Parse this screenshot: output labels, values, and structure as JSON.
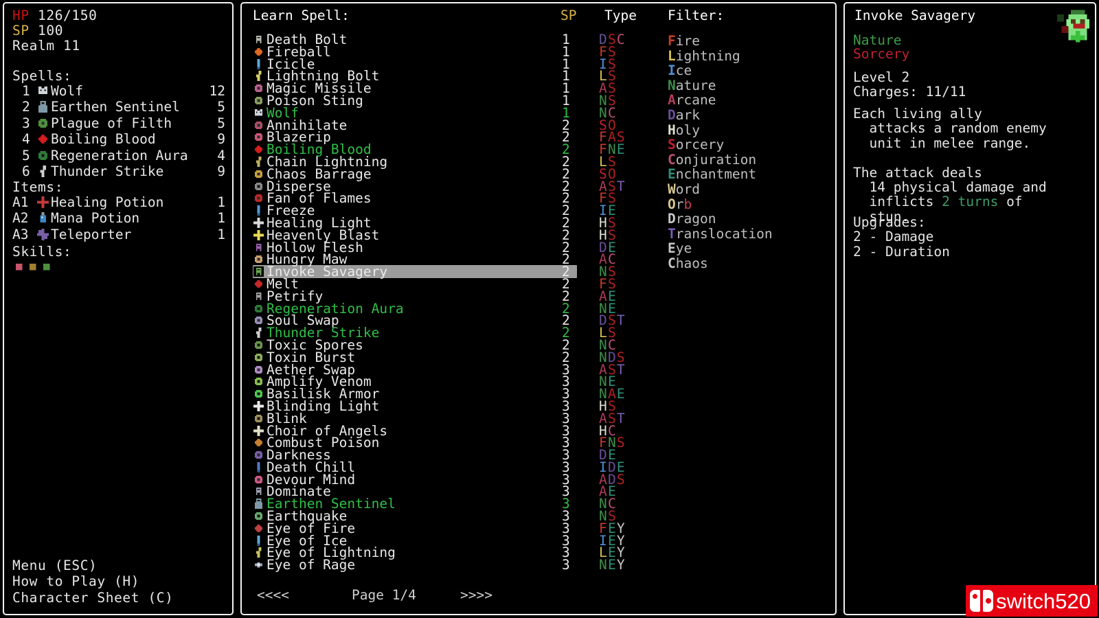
{
  "stats": {
    "hp_label": "HP",
    "hp_value": "126/150",
    "sp_label": "SP",
    "sp_value": "100",
    "realm": "Realm 11"
  },
  "spells_section": {
    "heading": "Spells:",
    "items": [
      {
        "num": "1",
        "name": "Wolf",
        "count": "12",
        "icon": "wolf-icon",
        "color": "#cfd4d8"
      },
      {
        "num": "2",
        "name": "Earthen Sentinel",
        "count": "5",
        "icon": "sentinel-icon",
        "color": "#7f9aa6"
      },
      {
        "num": "3",
        "name": "Plague of Filth",
        "count": "5",
        "icon": "plague-icon",
        "color": "#4f8f3f"
      },
      {
        "num": "4",
        "name": "Boiling Blood",
        "count": "9",
        "icon": "blood-icon",
        "color": "#d61c1c"
      },
      {
        "num": "5",
        "name": "Regeneration Aura",
        "count": "4",
        "icon": "regen-icon",
        "color": "#2f7a3a"
      },
      {
        "num": "6",
        "name": "Thunder Strike",
        "count": "9",
        "icon": "thunder-icon",
        "color": "#cfcfcf"
      }
    ]
  },
  "items_section": {
    "heading": "Items:",
    "items": [
      {
        "slot": "A1",
        "name": "Healing Potion",
        "count": "1",
        "icon": "healing-potion-icon",
        "color": "#c43a3a"
      },
      {
        "slot": "A2",
        "name": "Mana Potion",
        "count": "1",
        "icon": "mana-potion-icon",
        "color": "#3a86c4"
      },
      {
        "slot": "A3",
        "name": "Teleporter",
        "count": "1",
        "icon": "teleporter-icon",
        "color": "#7a5fa8"
      }
    ]
  },
  "skills_section": {
    "heading": "Skills:",
    "icons": [
      {
        "name": "skill-flesh-icon",
        "color": "#c8566b"
      },
      {
        "name": "skill-shield-icon",
        "color": "#a08030"
      },
      {
        "name": "skill-nature-icon",
        "color": "#4f8f3f"
      }
    ]
  },
  "footer": {
    "lines": [
      "Menu (ESC)",
      "How to Play (H)",
      "Character Sheet (C)"
    ]
  },
  "center": {
    "title": "Learn Spell:",
    "sp_header": "SP",
    "type_header": "Type",
    "filter_header": "Filter:",
    "pager": {
      "prev": "<<<<",
      "label": "Page 1/4",
      "next": ">>>>"
    }
  },
  "spell_list": [
    {
      "name": "Death Bolt",
      "sp": "1",
      "type": "DSC",
      "icon": "skull-icon",
      "icon_color": "#b8b8b0",
      "known": false
    },
    {
      "name": "Fireball",
      "sp": "1",
      "type": "FS",
      "icon": "fireball-icon",
      "icon_color": "#e06a20",
      "known": false
    },
    {
      "name": "Icicle",
      "sp": "1",
      "type": "IS",
      "icon": "icicle-icon",
      "icon_color": "#5fa8d8",
      "known": false
    },
    {
      "name": "Lightning Bolt",
      "sp": "1",
      "type": "LS",
      "icon": "lightning-icon",
      "icon_color": "#d8cf6a",
      "known": false
    },
    {
      "name": "Magic Missile",
      "sp": "1",
      "type": "AS",
      "icon": "missile-icon",
      "icon_color": "#c06090",
      "known": false
    },
    {
      "name": "Poison Sting",
      "sp": "1",
      "type": "NS",
      "icon": "sting-icon",
      "icon_color": "#8aa060",
      "known": false
    },
    {
      "name": "Wolf",
      "sp": "1",
      "type": "NC",
      "icon": "wolf-icon",
      "icon_color": "#cfd4d8",
      "known": true
    },
    {
      "name": "Annihilate",
      "sp": "2",
      "type": "SO",
      "icon": "annihilate-icon",
      "icon_color": "#b0506a",
      "known": false
    },
    {
      "name": "Blazerip",
      "sp": "2",
      "type": "FAS",
      "icon": "blazerip-icon",
      "icon_color": "#d05878",
      "known": false
    },
    {
      "name": "Boiling Blood",
      "sp": "2",
      "type": "FNE",
      "icon": "blood-icon",
      "icon_color": "#d61c1c",
      "known": true
    },
    {
      "name": "Chain Lightning",
      "sp": "2",
      "type": "LS",
      "icon": "chain-icon",
      "icon_color": "#c0b060",
      "known": false
    },
    {
      "name": "Chaos Barrage",
      "sp": "2",
      "type": "SO",
      "icon": "chaos-icon",
      "icon_color": "#c8a040",
      "known": false
    },
    {
      "name": "Disperse",
      "sp": "2",
      "type": "AST",
      "icon": "disperse-icon",
      "icon_color": "#8a8a8a",
      "known": false
    },
    {
      "name": "Fan of Flames",
      "sp": "2",
      "type": "FS",
      "icon": "fan-icon",
      "icon_color": "#c02828",
      "known": false
    },
    {
      "name": "Freeze",
      "sp": "2",
      "type": "IE",
      "icon": "freeze-icon",
      "icon_color": "#4f9ad8",
      "known": false
    },
    {
      "name": "Healing Light",
      "sp": "2",
      "type": "HS",
      "icon": "heal-icon",
      "icon_color": "#d8d8d8",
      "known": false
    },
    {
      "name": "Heavenly Blast",
      "sp": "2",
      "type": "HS",
      "icon": "heavenly-icon",
      "icon_color": "#e8d858",
      "known": false
    },
    {
      "name": "Hollow Flesh",
      "sp": "2",
      "type": "DE",
      "icon": "hollow-icon",
      "icon_color": "#9a60b0",
      "known": false
    },
    {
      "name": "Hungry Maw",
      "sp": "2",
      "type": "AC",
      "icon": "maw-icon",
      "icon_color": "#c8a070",
      "known": false
    },
    {
      "name": "Invoke Savagery",
      "sp": "2",
      "type": "NS",
      "icon": "savagery-icon",
      "icon_color": "#6aa850",
      "known": false,
      "selected": true
    },
    {
      "name": "Melt",
      "sp": "2",
      "type": "FS",
      "icon": "melt-icon",
      "icon_color": "#c82828",
      "known": false
    },
    {
      "name": "Petrify",
      "sp": "2",
      "type": "AE",
      "icon": "petrify-icon",
      "icon_color": "#a0a0a0",
      "known": false
    },
    {
      "name": "Regeneration Aura",
      "sp": "2",
      "type": "NE",
      "icon": "regen-icon",
      "icon_color": "#2f7a3a",
      "known": true
    },
    {
      "name": "Soul Swap",
      "sp": "2",
      "type": "DST",
      "icon": "soulswap-icon",
      "icon_color": "#9a90b8",
      "known": false
    },
    {
      "name": "Thunder Strike",
      "sp": "2",
      "type": "LS",
      "icon": "thunder-icon",
      "icon_color": "#cfcfcf",
      "known": true
    },
    {
      "name": "Toxic Spores",
      "sp": "2",
      "type": "NC",
      "icon": "spores-icon",
      "icon_color": "#6a9850",
      "known": false
    },
    {
      "name": "Toxin Burst",
      "sp": "2",
      "type": "NDS",
      "icon": "toxin-icon",
      "icon_color": "#90b060",
      "known": false
    },
    {
      "name": "Aether Swap",
      "sp": "3",
      "type": "AST",
      "icon": "aether-icon",
      "icon_color": "#b08fc8",
      "known": false
    },
    {
      "name": "Amplify Venom",
      "sp": "3",
      "type": "NE",
      "icon": "venom-icon",
      "icon_color": "#8ac050",
      "known": false
    },
    {
      "name": "Basilisk Armor",
      "sp": "3",
      "type": "NAE",
      "icon": "basilisk-icon",
      "icon_color": "#4fc850",
      "known": false
    },
    {
      "name": "Blinding Light",
      "sp": "3",
      "type": "HS",
      "icon": "blinding-icon",
      "icon_color": "#e8e8e8",
      "known": false
    },
    {
      "name": "Blink",
      "sp": "3",
      "type": "AST",
      "icon": "blink-icon",
      "icon_color": "#a09060",
      "known": false
    },
    {
      "name": "Choir of Angels",
      "sp": "3",
      "type": "HC",
      "icon": "choir-icon",
      "icon_color": "#e0e0c8",
      "known": false
    },
    {
      "name": "Combust Poison",
      "sp": "3",
      "type": "FNS",
      "icon": "combust-icon",
      "icon_color": "#c88030",
      "known": false
    },
    {
      "name": "Darkness",
      "sp": "3",
      "type": "DE",
      "icon": "darkness-icon",
      "icon_color": "#7a5fa8",
      "known": false
    },
    {
      "name": "Death Chill",
      "sp": "3",
      "type": "IDE",
      "icon": "deathchill-icon",
      "icon_color": "#5878c8",
      "known": false
    },
    {
      "name": "Devour Mind",
      "sp": "3",
      "type": "ADS",
      "icon": "devour-icon",
      "icon_color": "#d05a8a",
      "known": false
    },
    {
      "name": "Dominate",
      "sp": "3",
      "type": "AE",
      "icon": "dominate-icon",
      "icon_color": "#9aa0b0",
      "known": false
    },
    {
      "name": "Earthen Sentinel",
      "sp": "3",
      "type": "NC",
      "icon": "sentinel-icon",
      "icon_color": "#7f9aa6",
      "known": true
    },
    {
      "name": "Earthquake",
      "sp": "3",
      "type": "NS",
      "icon": "earthquake-icon",
      "icon_color": "#6aa870",
      "known": false
    },
    {
      "name": "Eye of Fire",
      "sp": "3",
      "type": "FEY",
      "icon": "eye-fire-icon",
      "icon_color": "#c04040",
      "known": false
    },
    {
      "name": "Eye of Ice",
      "sp": "3",
      "type": "IEY",
      "icon": "eye-ice-icon",
      "icon_color": "#5fa8d8",
      "known": false
    },
    {
      "name": "Eye of Lightning",
      "sp": "3",
      "type": "LEY",
      "icon": "eye-lit-icon",
      "icon_color": "#c8c060",
      "known": false
    },
    {
      "name": "Eye of Rage",
      "sp": "3",
      "type": "NEY",
      "icon": "eye-rage-icon",
      "icon_color": "#a0a8b0",
      "known": false
    }
  ],
  "filters": [
    {
      "key": "F",
      "rest": "ire",
      "key_color": "#c83c2a"
    },
    {
      "key": "L",
      "rest": "ightning",
      "key_color": "#d8c050"
    },
    {
      "key": "I",
      "rest": "ce",
      "key_color": "#4f8fd8"
    },
    {
      "key": "N",
      "rest": "ature",
      "key_color": "#3f8f4a"
    },
    {
      "key": "A",
      "rest": "rcane",
      "key_color": "#b03a5a"
    },
    {
      "key": "D",
      "rest": "ark",
      "key_color": "#6a4f9a"
    },
    {
      "key": "H",
      "rest": "oly",
      "key_color": "#e0e0d0"
    },
    {
      "key": "S",
      "rest": "orcery",
      "key_color": "#c02030"
    },
    {
      "key": "C",
      "rest": "onjuration",
      "key_color": "#c04f7a"
    },
    {
      "key": "E",
      "rest": "nchantment",
      "key_color": "#2f8f7a"
    },
    {
      "key": "W",
      "rest": "ord",
      "key_color": "#d8c890"
    },
    {
      "key": "O",
      "rest": "r",
      "key_color": "#d8c890",
      "tail": "b",
      "tail_color": "#c83c5a"
    },
    {
      "key": "D",
      "rest": "ragon",
      "key_color": "#c8c8c8",
      "tail": "",
      "tail_color": ""
    },
    {
      "key": "T",
      "rest": "ranslocation",
      "key_color": "#7a5fb8"
    },
    {
      "key": "E",
      "rest": "ye",
      "key_color": "#c8c8c8"
    },
    {
      "key": "C",
      "rest": "haos",
      "key_color": "#c8c8c8"
    }
  ],
  "detail": {
    "name": "Invoke Savagery",
    "school_primary": "Nature",
    "school_secondary": "Sorcery",
    "level": "Level 2",
    "charges": "Charges: 11/11",
    "description_lines": [
      "Each living ally",
      "  attacks a random enemy",
      "  unit in melee range.",
      "",
      "The attack deals",
      "  14 physical damage and",
      "  inflicts 2 turns of",
      "  stun."
    ],
    "highlight_text": "2 turns",
    "upgrades_heading": "Upgrades:",
    "upgrades": [
      "2 - Damage",
      "2 - Duration"
    ],
    "sprite_name": "goblin-sprite"
  },
  "watermark": {
    "text": "switch520",
    "logo": "nintendo-switch-icon",
    "color": "#e60012"
  },
  "colors": {
    "known_green": "#2fbf46",
    "highlight_bar": "#9c9c9c",
    "hp_red": "#cc1111",
    "sp_gold": "#d8b24a",
    "type_red": "#b02020",
    "panel_border": "#f2f2f2"
  }
}
